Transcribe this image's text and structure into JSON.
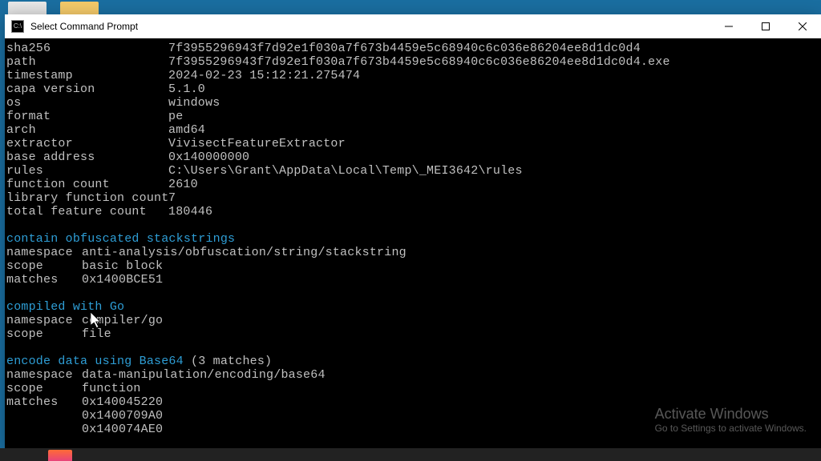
{
  "window": {
    "title": "Select Command Prompt"
  },
  "meta": {
    "rows": [
      {
        "key": "sha256",
        "val": "7f3955296943f7d92e1f030a7f673b4459e5c68940c6c036e86204ee8d1dc0d4"
      },
      {
        "key": "path",
        "val": "7f3955296943f7d92e1f030a7f673b4459e5c68940c6c036e86204ee8d1dc0d4.exe"
      },
      {
        "key": "timestamp",
        "val": "2024-02-23 15:12:21.275474"
      },
      {
        "key": "capa version",
        "val": "5.1.0"
      },
      {
        "key": "os",
        "val": "windows"
      },
      {
        "key": "format",
        "val": "pe"
      },
      {
        "key": "arch",
        "val": "amd64"
      },
      {
        "key": "extractor",
        "val": "VivisectFeatureExtractor"
      },
      {
        "key": "base address",
        "val": "0x140000000"
      },
      {
        "key": "rules",
        "val": "C:\\Users\\Grant\\AppData\\Local\\Temp\\_MEI3642\\rules"
      },
      {
        "key": "function count",
        "val": "2610"
      },
      {
        "key": "library function count",
        "val": "7"
      },
      {
        "key": "total feature count",
        "val": "180446"
      }
    ]
  },
  "rules": [
    {
      "title": "contain obfuscated stackstrings",
      "suffix": "",
      "details": [
        {
          "key": "namespace",
          "val": "anti-analysis/obfuscation/string/stackstring"
        },
        {
          "key": "scope",
          "val": "basic block"
        },
        {
          "key": "matches",
          "val": "0x1400BCE51"
        }
      ],
      "extra_matches": []
    },
    {
      "title": "compiled with Go",
      "suffix": "",
      "details": [
        {
          "key": "namespace",
          "val": "compiler/go"
        },
        {
          "key": "scope",
          "val": "file"
        }
      ],
      "extra_matches": []
    },
    {
      "title": "encode data using Base64",
      "suffix": " (3 matches)",
      "details": [
        {
          "key": "namespace",
          "val": "data-manipulation/encoding/base64"
        },
        {
          "key": "scope",
          "val": "function"
        },
        {
          "key": "matches",
          "val": "0x140045220"
        }
      ],
      "extra_matches": [
        "0x1400709A0",
        "0x140074AE0"
      ]
    }
  ],
  "watermark": {
    "line1": "Activate Windows",
    "line2": "Go to Settings to activate Windows."
  }
}
